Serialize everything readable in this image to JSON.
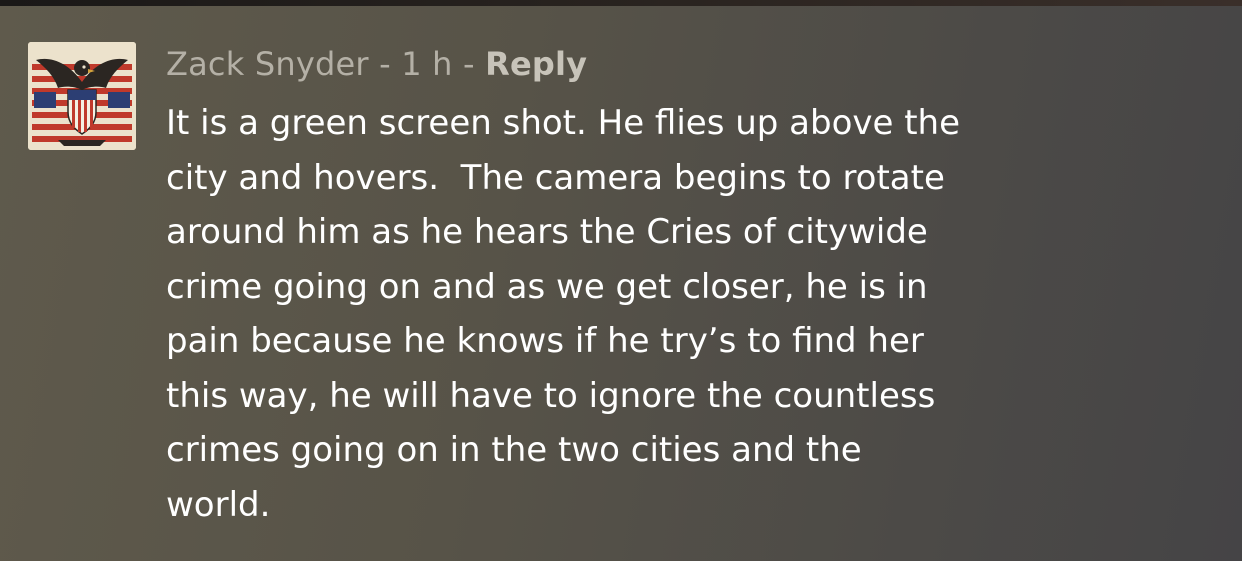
{
  "comment": {
    "author": "Zack Snyder",
    "separator_1": " - ",
    "time": "1 h",
    "separator_2": " - ",
    "reply_label": "Reply",
    "avatar_icon": "eagle-flag-emblem-icon",
    "text_lines": [
      "It is a green screen shot. He flies up above the",
      "city and hovers.  The camera begins to rotate",
      "around him as he hears the Cries of citywide",
      "crime going on and as we get closer, he is in",
      "pain because he knows if he try’s to find her",
      "this way, he will have to ignore the countless",
      "crimes going on in the two cities and the",
      "world."
    ]
  },
  "colors": {
    "background": "#57534a",
    "meta_text": "#b4b0a6",
    "body_text": "#ffffff",
    "flag_red": "#c0392b",
    "flag_blue": "#2c3e73"
  }
}
